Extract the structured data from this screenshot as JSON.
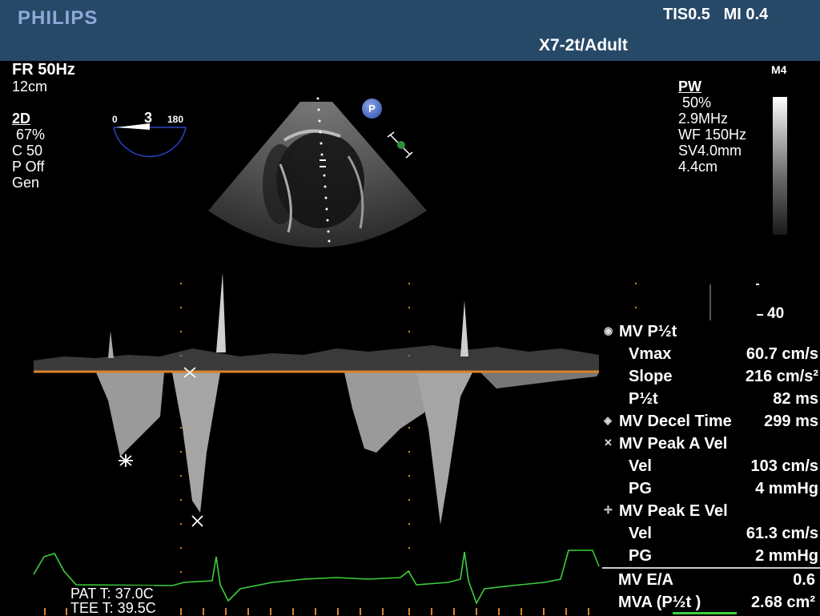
{
  "header": {
    "brand": "PHILIPS",
    "tis_mi": "TIS0.5   MI 0.4",
    "probe_preset": "X7-2t/Adult"
  },
  "left_params": {
    "fr": "FR 50Hz",
    "depth": "12cm",
    "mode": "2D",
    "gain": " 67%",
    "compress": "C 50",
    "persistence": "P Off",
    "resolution": "Gen"
  },
  "angle_indicator": {
    "min": "0",
    "value": "3",
    "max": "180"
  },
  "pw_params": {
    "mode": "PW",
    "gain": " 50%",
    "freq": "2.9MHz",
    "wall_filter": "WF 150Hz",
    "sample_volume": "SV4.0mm",
    "depth": "4.4cm"
  },
  "map_label": "M4",
  "p_badge": "P",
  "scale_label": "40",
  "measurements": [
    {
      "marker": "circle-dot",
      "label": "MV P½t",
      "value": "",
      "sub": false
    },
    {
      "marker": "",
      "label": "Vmax",
      "value": "60.7 cm/s",
      "sub": true
    },
    {
      "marker": "",
      "label": "Slope",
      "value": "216 cm/s²",
      "sub": true
    },
    {
      "marker": "",
      "label": "P½t",
      "value": "82 ms",
      "sub": true
    },
    {
      "marker": "diamond",
      "label": "MV Decel Time",
      "value": "299 ms",
      "sub": false
    },
    {
      "marker": "x",
      "label": "MV Peak A Vel",
      "value": "",
      "sub": false
    },
    {
      "marker": "",
      "label": "Vel",
      "value": "103 cm/s",
      "sub": true
    },
    {
      "marker": "",
      "label": "PG",
      "value": "4 mmHg",
      "sub": true
    },
    {
      "marker": "plus",
      "label": "MV Peak E Vel",
      "value": "",
      "sub": false
    },
    {
      "marker": "",
      "label": "Vel",
      "value": "61.3 cm/s",
      "sub": true
    },
    {
      "marker": "",
      "label": "PG",
      "value": "2 mmHg",
      "sub": true
    }
  ],
  "summary": [
    {
      "label": "MV E/A",
      "value": "0.6"
    },
    {
      "label": "MVA (P½t )",
      "value": "2.68 cm²"
    }
  ],
  "temps": {
    "pat": "PAT T: 37.0C",
    "tee": "TEE T: 39.5C"
  },
  "colors": {
    "header_bg": "#274968",
    "brand": "#8ea9d8",
    "baseline": "#d9822b",
    "ecg": "#3ccf3c",
    "scale_ring": "#2a44c8"
  }
}
